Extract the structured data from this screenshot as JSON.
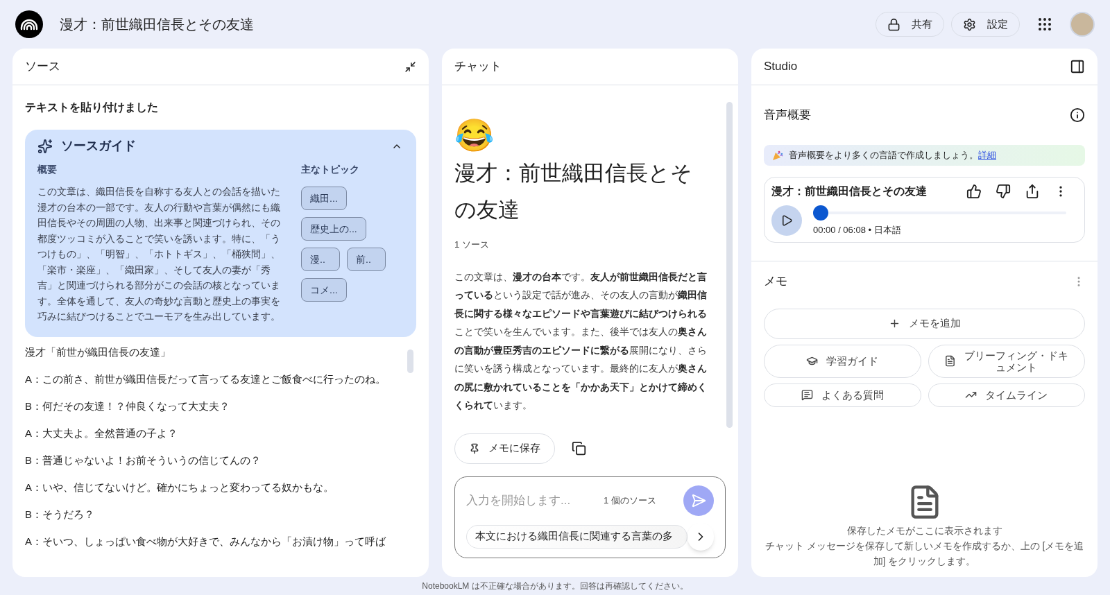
{
  "app": {
    "title": "漫才：前世織田信長とその友達"
  },
  "header_buttons": [
    {
      "kind": "share",
      "label": "共有"
    },
    {
      "kind": "settings",
      "label": "設定"
    }
  ],
  "sources": {
    "title": "ソース",
    "pasted_heading": "テキストを貼り付けました",
    "guide": {
      "title": "ソースガイド",
      "expanded": true,
      "summary_label": "概要",
      "summary": "この文章は、織田信長を自称する友人との会話を描いた漫才の台本の一部です。友人の行動や言葉が偶然にも織田信長やその周囲の人物、出来事と関連づけられ、その都度ツッコミが入ることで笑いを誘います。特に、「うつけもの」、「明智」、「ホトトギス」、「桶狭間」、「楽市・楽座」、「織田家」、そして友人の妻が「秀吉」と関連づけられる部分がこの会話の核となっています。全体を通して、友人の奇妙な言動と歴史上の事実を巧みに結びつけることでユーモアを生み出しています。",
      "topics_label": "主なトピック",
      "topics": [
        "織田...",
        "歴史上の...",
        "漫..",
        "前..",
        "コメ..."
      ]
    },
    "lines": [
      "漫才「前世が織田信長の友達」",
      "A：この前さ、前世が織田信長だって言ってる友達とご飯食べに行ったのね。",
      "B：何だその友達！？仲良くなって大丈夫？",
      "A：大丈夫よ。全然普通の子よ？",
      "B：普通じゃないよ！お前そういうの信じてんの？",
      "A：いや、信じてないけど。確かにちょっと変わってる奴かもな。",
      "B：そうだろ？",
      "A：そいつ、しょっぱい食べ物が大好きで、みんなから「お漬け物」って呼ば"
    ]
  },
  "chat": {
    "title": "チャット",
    "emoji": "😂",
    "heading": "漫才：前世織田信長とその友達",
    "source_count": "1 ソース",
    "summary": "この文章は、**漫才の台本**です。**友人が前世織田信長だと言っている**という設定で話が進み、その友人の言動が**織田信長に関する様々なエピソードや言葉遊びに結びつけられる**ことで笑いを生んでいます。また、後半では友人の**奥さんの言動が豊臣秀吉のエピソードに繋がる**展開になり、さらに笑いを誘う構成となっています。最終的に友人が**奥さんの尻に敷かれていることを「かかあ天下」とかけて締めくくられて**います。",
    "save_button": "メモに保存",
    "input": {
      "placeholder": "入力を開始します...",
      "source_count": "1 個のソース"
    },
    "suggestion": "本文における織田信長に関連する言葉の多"
  },
  "studio": {
    "title": "Studio",
    "audio": {
      "title": "音声概要",
      "banner": "音声概要をより多くの言語で作成しましょう。",
      "banner_link": "詳細",
      "item": {
        "title": "漫才：前世織田信長とその友達",
        "time": "00:00 / 06:08 • 日本語",
        "level": 0
      }
    },
    "notes": {
      "title": "メモ",
      "add_button": "メモを追加",
      "tools": [
        {
          "kind": "study",
          "label": "学習ガイド"
        },
        {
          "kind": "briefing",
          "label": "ブリーフィング・ドキュメント"
        },
        {
          "kind": "faq",
          "label": "よくある質問"
        },
        {
          "kind": "timeline",
          "label": "タイムライン"
        }
      ],
      "empty_title": "保存したメモがここに表示されます",
      "empty_text": "チャット メッセージを保存して新しいメモを作成するか、上の [メモを追加] をクリックします。"
    }
  },
  "footer": "NotebookLM は不正確な場合があります。回答は再確認してください。"
}
